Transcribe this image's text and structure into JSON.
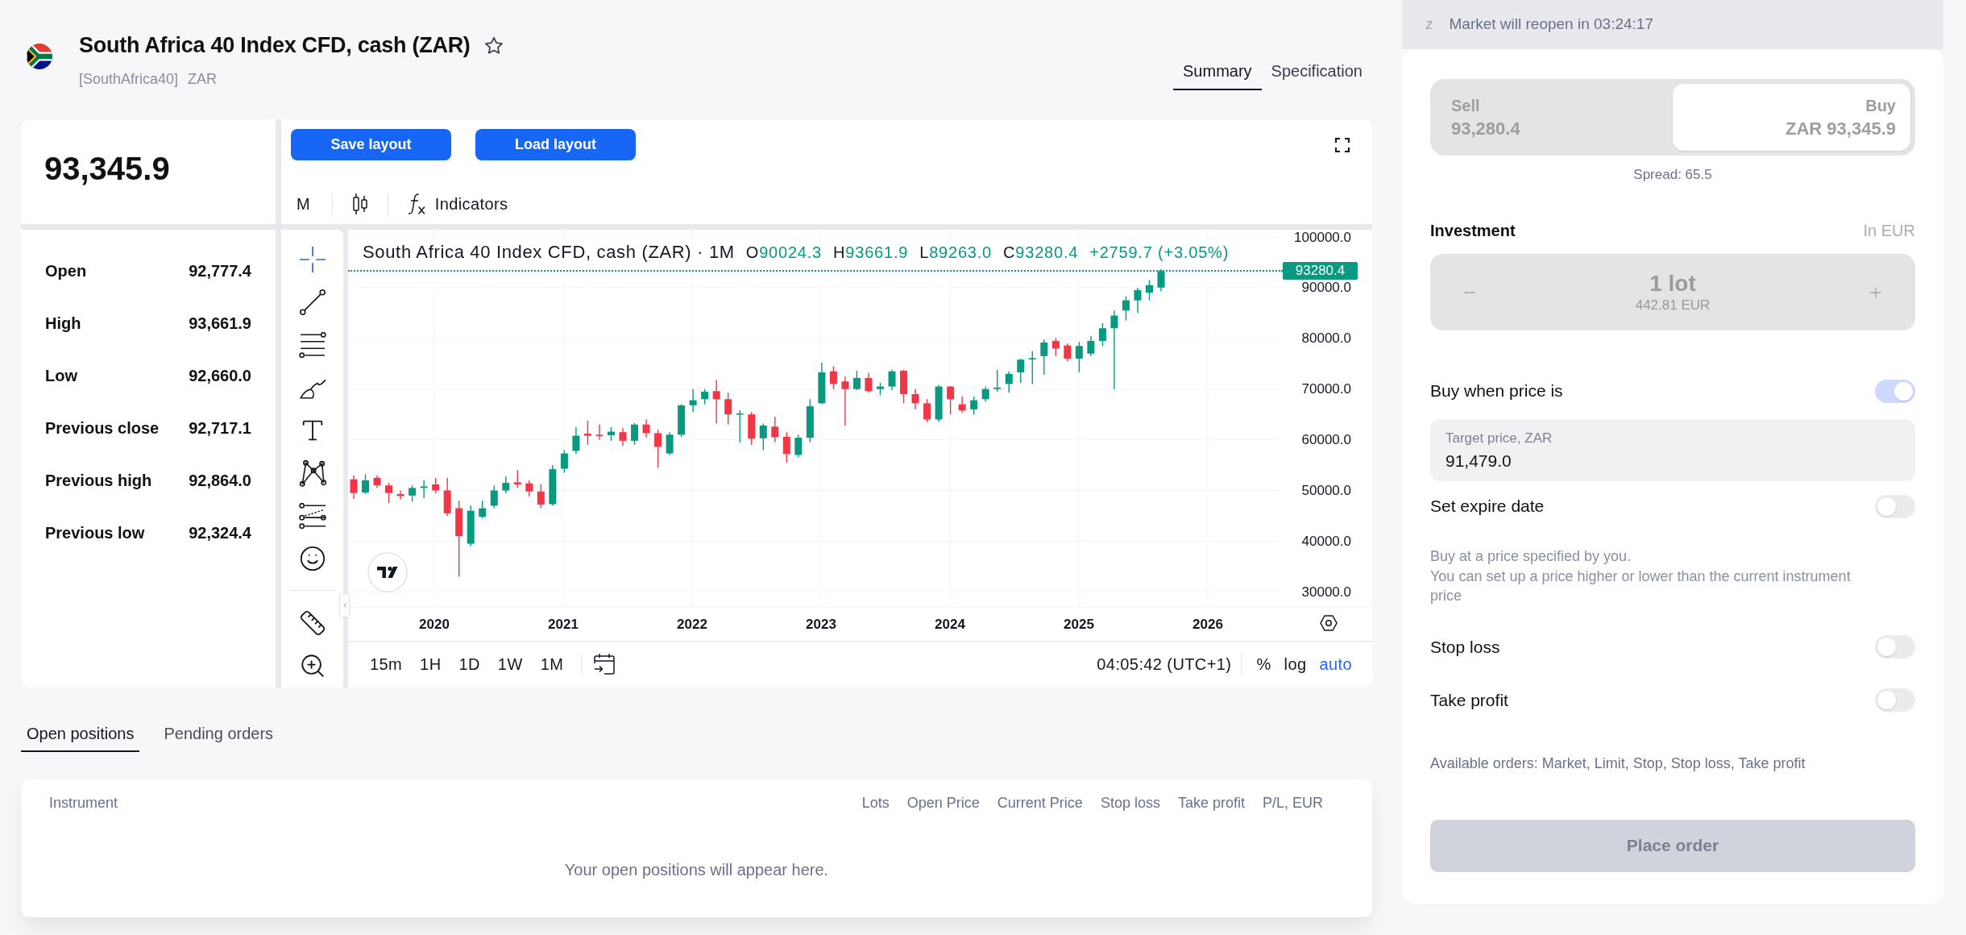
{
  "instrument": {
    "title": "South Africa 40 Index CFD, cash (ZAR)",
    "favorite": false,
    "symbol": "[SouthAfrica40]",
    "currency": "ZAR"
  },
  "view_tabs": [
    {
      "label": "Summary",
      "selected": true
    },
    {
      "label": "Specification",
      "selected": false
    }
  ],
  "quote": {
    "price": "93,345.9",
    "stats": [
      {
        "label": "Open",
        "value": "92,777.4"
      },
      {
        "label": "High",
        "value": "93,661.9"
      },
      {
        "label": "Low",
        "value": "92,660.0"
      },
      {
        "label": "Previous close",
        "value": "92,717.1"
      },
      {
        "label": "Previous high",
        "value": "92,864.0"
      },
      {
        "label": "Previous low",
        "value": "92,324.4"
      }
    ]
  },
  "chart_panel": {
    "buttons": [
      "Save layout",
      "Load layout"
    ],
    "interval": "M",
    "indicators": "Indicators",
    "drawing_tools": [
      {
        "kind": "crosshair",
        "selected": true
      },
      {
        "kind": "trend_line",
        "selected": false
      },
      {
        "kind": "fib",
        "selected": false
      },
      {
        "kind": "brush",
        "selected": false
      },
      {
        "kind": "text",
        "selected": false
      },
      {
        "kind": "pattern",
        "selected": false
      },
      {
        "kind": "projection",
        "selected": false
      },
      {
        "kind": "emoji",
        "selected": false
      }
    ],
    "measure_tools": [
      {
        "kind": "ruler",
        "selected": false
      },
      {
        "kind": "zoom",
        "selected": false
      }
    ],
    "legend": {
      "title": "South Africa 40 Index CFD, cash (ZAR) · 1M",
      "ohlc": [
        {
          "key": "O",
          "value": "90024.3"
        },
        {
          "key": "H",
          "value": "93661.9"
        },
        {
          "key": "L",
          "value": "89263.0"
        },
        {
          "key": "C",
          "value": "93280.4"
        }
      ],
      "change": "+2759.7 (+3.05%)"
    },
    "last_price": "93280.4",
    "price_axis": [
      "100000.0",
      "90000.0",
      "80000.0",
      "70000.0",
      "60000.0",
      "50000.0",
      "40000.0",
      "30000.0"
    ],
    "time_axis": [
      "2020",
      "2021",
      "2022",
      "2023",
      "2024",
      "2025",
      "2026"
    ],
    "timeframes": [
      "15m",
      "1H",
      "1D",
      "1W",
      "1M"
    ],
    "clock": "04:05:42 (UTC+1)",
    "scale_options": [
      {
        "label": "%",
        "selected": false
      },
      {
        "label": "log",
        "selected": false
      },
      {
        "label": "auto",
        "selected": true
      }
    ]
  },
  "positions": {
    "tabs": [
      {
        "label": "Open positions",
        "selected": true
      },
      {
        "label": "Pending orders",
        "selected": false
      }
    ],
    "columns": [
      "Instrument",
      "Lots",
      "Open Price",
      "Current Price",
      "Stop loss",
      "Take profit",
      "P/L, EUR"
    ],
    "empty_message": "Your open positions will appear here."
  },
  "order_panel": {
    "banner_icon": "z",
    "banner": "Market will reopen in 03:24:17",
    "sides": [
      {
        "label": "Sell",
        "price": "93,280.4",
        "selected": false
      },
      {
        "label": "Buy",
        "price": "ZAR 93,345.9",
        "selected": true
      }
    ],
    "spread": "Spread: 65.5",
    "investment": {
      "label": "Investment",
      "unit": "In EUR",
      "amount": "1 lot",
      "value": "442.81 EUR"
    },
    "options": [
      {
        "kind": "toggle",
        "label": "Buy when price is",
        "on": true
      },
      {
        "kind": "field",
        "label": "Target price, ZAR",
        "value": "91,479.0"
      },
      {
        "kind": "toggle",
        "label": "Set expire date",
        "on": false
      },
      {
        "kind": "note",
        "lines": [
          "Buy at a price specified by you.",
          "You can set up a price higher or lower than the current instrument price"
        ]
      },
      {
        "kind": "toggle",
        "label": "Stop loss",
        "on": false
      },
      {
        "kind": "toggle",
        "label": "Take profit",
        "on": false
      }
    ],
    "available_orders": "Available orders: Market, Limit, Stop, Stop loss, Take profit",
    "submit": {
      "label": "Place order",
      "disabled": true
    }
  }
}
